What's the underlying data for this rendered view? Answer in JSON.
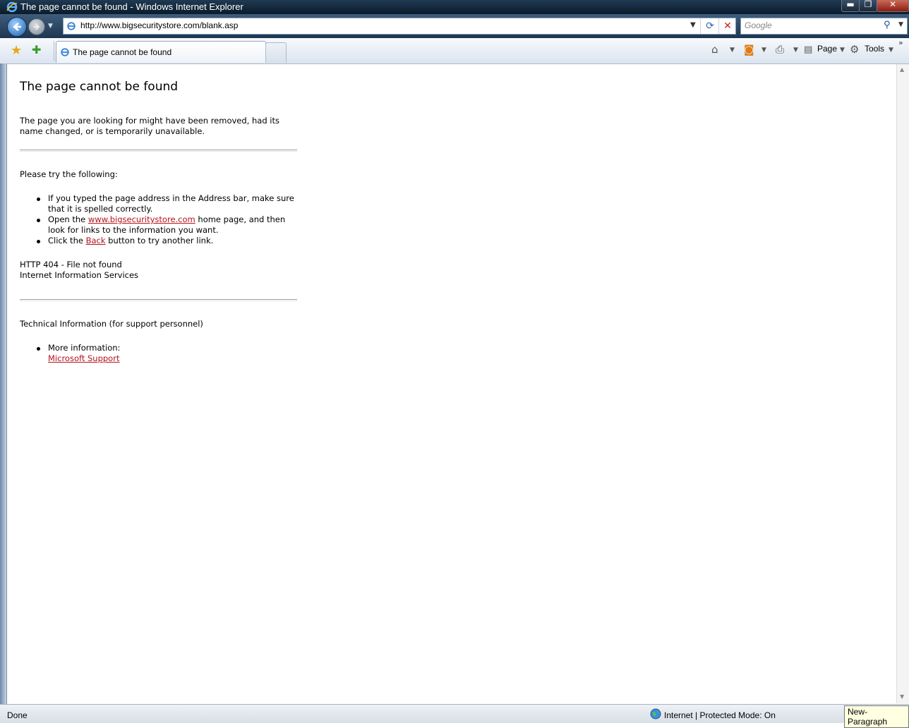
{
  "window": {
    "title": "The page cannot be found - Windows Internet Explorer",
    "min_label": "▬",
    "max_label": "❐",
    "close_label": "✕"
  },
  "nav": {
    "address": "http://www.bigsecuritystore.com/blank.asp",
    "search_placeholder": "Google"
  },
  "tabs": [
    {
      "label": "The page cannot be found",
      "active": true
    }
  ],
  "commands": {
    "page_label": "Page",
    "tools_label": "Tools"
  },
  "content": {
    "heading": "The page cannot be found",
    "intro_line1": "The page you are looking for might have been removed, had its",
    "intro_line2": "name changed, or is temporarily unavailable.",
    "try_heading": "Please try the following:",
    "item1_line1": "If you typed the page address in the Address bar, make sure",
    "item1_line2": "that it is spelled correctly.",
    "item2_pre": "Open the ",
    "item2_link": "www.bigsecuritystore.com",
    "item2_post": " home page, and then",
    "item2_line2": "look for links to the information you want.",
    "item3_pre": "Click the ",
    "item3_link": "Back",
    "item3_post": " button to try another link.",
    "error_code": "HTTP 404 - File not found",
    "server": "Internet Information Services",
    "tech_heading": "Technical Information (for support personnel)",
    "more_info": "More information:",
    "support_link": "Microsoft Support"
  },
  "status": {
    "text": "Done",
    "zone": "Internet | Protected Mode: On",
    "tooltip": "New-Paragraph"
  },
  "colors": {
    "link": "#b3141c",
    "titlebar": "#0b1b2b"
  }
}
